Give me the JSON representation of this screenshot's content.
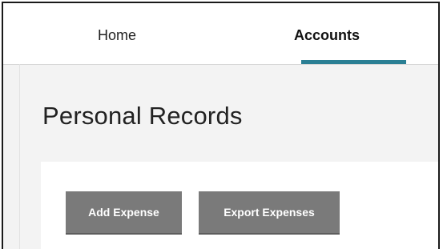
{
  "nav": {
    "tabs": [
      {
        "label": "Home",
        "active": false
      },
      {
        "label": "Accounts",
        "active": true
      }
    ],
    "active_color": "#2a7f94"
  },
  "page": {
    "title": "Personal Records"
  },
  "toolbar": {
    "add_label": "Add Expense",
    "export_label": "Export Expenses",
    "button_color": "#7a7a7a"
  }
}
